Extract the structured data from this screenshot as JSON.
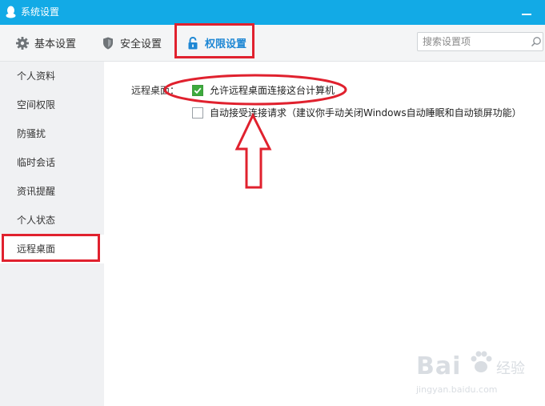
{
  "window": {
    "title": "系统设置",
    "title_bar_color": "#12aae6"
  },
  "toolbar": {
    "tabs": [
      {
        "label": "基本设置",
        "icon": "gear-icon"
      },
      {
        "label": "安全设置",
        "icon": "shield-icon"
      },
      {
        "label": "权限设置",
        "icon": "lock-icon",
        "active": true
      }
    ],
    "search": {
      "placeholder": "搜索设置项",
      "value": ""
    }
  },
  "sidebar": {
    "items": [
      {
        "label": "个人资料"
      },
      {
        "label": "空间权限"
      },
      {
        "label": "防骚扰"
      },
      {
        "label": "临时会话"
      },
      {
        "label": "资讯提醒"
      },
      {
        "label": "个人状态"
      },
      {
        "label": "远程桌面",
        "selected": true
      }
    ]
  },
  "content": {
    "section_label": "远程桌面：",
    "options": [
      {
        "label": "允许远程桌面连接这台计算机",
        "checked": true
      },
      {
        "label": "自动接受连接请求（建议你手动关闭Windows自动睡眠和自动锁屏功能）",
        "checked": false
      }
    ]
  },
  "colors": {
    "accent": "#1e87d4",
    "annotation_red": "#e0212e",
    "check_green": "#3eaa3e"
  },
  "watermark": {
    "main": "Bai",
    "sub": "经验",
    "url": "jingyan.baidu.com"
  }
}
